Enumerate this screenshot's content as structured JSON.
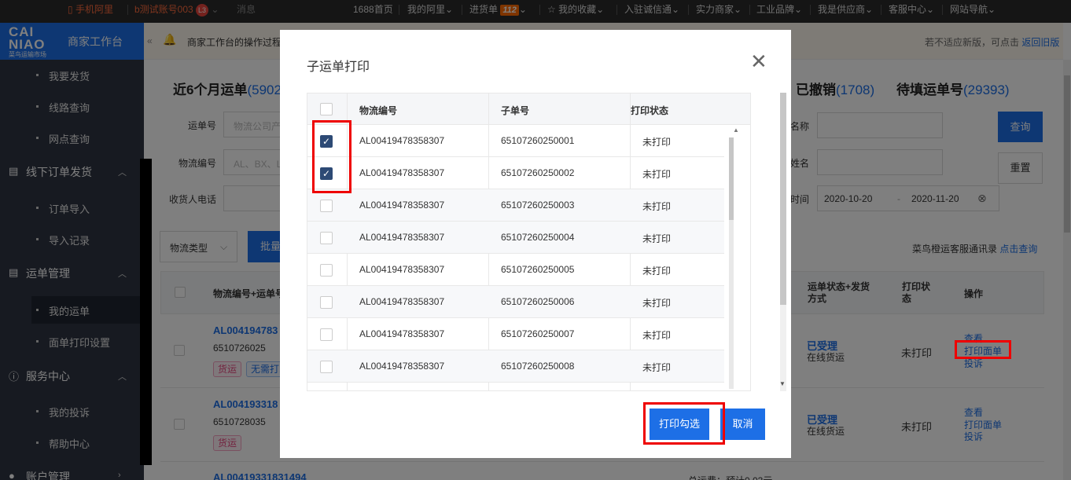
{
  "topbar": {
    "phone_ali": "手机阿里",
    "account": "b测试账号003",
    "level": "L3",
    "message": "消息",
    "home": "1688首页",
    "my_ali": "我的阿里",
    "purchase": "进货单",
    "purchase_count": "112",
    "favorites": "我的收藏",
    "join": "入驻诚信通",
    "merchants": "实力商家",
    "industry": "工业品牌",
    "supplier": "我是供应商",
    "service": "客服中心",
    "sitenav": "网站导航"
  },
  "sidebar": {
    "logo_top": "CAI",
    "logo_bottom": "NIAO",
    "logo_sub": "菜鸟运输市场",
    "title": "商家工作台",
    "items": {
      "send": "我要发货",
      "route": "线路查询",
      "outlet": "网点查询",
      "offline_section": "线下订单发货",
      "order_import": "订单导入",
      "import_record": "导入记录",
      "waybill_section": "运单管理",
      "my_waybill": "我的运单",
      "print_setting": "面单打印设置",
      "service_section": "服务中心",
      "my_complaint": "我的投诉",
      "help": "帮助中心",
      "account_section": "账户管理"
    }
  },
  "notice": {
    "text": "商家工作台的操作过程",
    "right_text": "若不适应新版，可点击",
    "right_link": "返回旧版"
  },
  "tabs": {
    "recent_label": "近6个月运单",
    "recent_count": "(59022",
    "cancelled_label": "已撤销",
    "cancelled_count": "(1708)",
    "pending_label": "待填运单号",
    "pending_count": "(29393)"
  },
  "filters": {
    "waybill_label": "运单号",
    "waybill_placeholder": "物流公司产",
    "logistics_label": "物流编号",
    "logistics_placeholder": "AL、BX、L",
    "phone_label": "收货人电话",
    "name_label": "名称",
    "person_label": "姓名",
    "time_label": "时间",
    "date_from": "2020-10-20",
    "date_sep": "-",
    "date_to": "2020-11-20",
    "query": "查询",
    "reset": "重置",
    "type_select": "物流类型",
    "batch": "批量",
    "service_record": "菜鸟橙运客服通讯录",
    "service_link": "点击查询"
  },
  "table": {
    "col_logistics": "物流编号+运单号",
    "col_status": "运单状态+发货方式",
    "col_print": "打印状态",
    "col_op": "操作",
    "rows": [
      {
        "id": "AL004194783",
        "sub": "6510726025",
        "tag1": "货运",
        "tag2": "无需打印",
        "status": "已受理",
        "mode": "在线货运",
        "print": "未打印",
        "op1": "查看",
        "op2": "打印面单",
        "op3": "投诉"
      },
      {
        "id": "AL004193318",
        "sub": "6510728035",
        "tag1": "货运",
        "status": "已受理",
        "mode": "在线货运",
        "print": "未打印",
        "op1": "查看",
        "op2": "打印面单",
        "op3": "投诉"
      },
      {
        "id": "AL00419331831494",
        "fee": "总运费：预计0.03元"
      }
    ]
  },
  "modal": {
    "title": "子运单打印",
    "close": "×",
    "col_logistics": "物流编号",
    "col_sub": "子单号",
    "col_status": "打印状态",
    "rows": [
      {
        "id": "AL00419478358307",
        "sub": "65107260250001",
        "status": "未打印",
        "checked": true
      },
      {
        "id": "AL00419478358307",
        "sub": "65107260250002",
        "status": "未打印",
        "checked": true
      },
      {
        "id": "AL00419478358307",
        "sub": "65107260250003",
        "status": "未打印",
        "checked": false
      },
      {
        "id": "AL00419478358307",
        "sub": "65107260250004",
        "status": "未打印",
        "checked": false
      },
      {
        "id": "AL00419478358307",
        "sub": "65107260250005",
        "status": "未打印",
        "checked": false
      },
      {
        "id": "AL00419478358307",
        "sub": "65107260250006",
        "status": "未打印",
        "checked": false
      },
      {
        "id": "AL00419478358307",
        "sub": "65107260250007",
        "status": "未打印",
        "checked": false
      },
      {
        "id": "AL00419478358307",
        "sub": "65107260250008",
        "status": "未打印",
        "checked": false
      }
    ],
    "print_btn": "打印勾选",
    "cancel_btn": "取消"
  }
}
